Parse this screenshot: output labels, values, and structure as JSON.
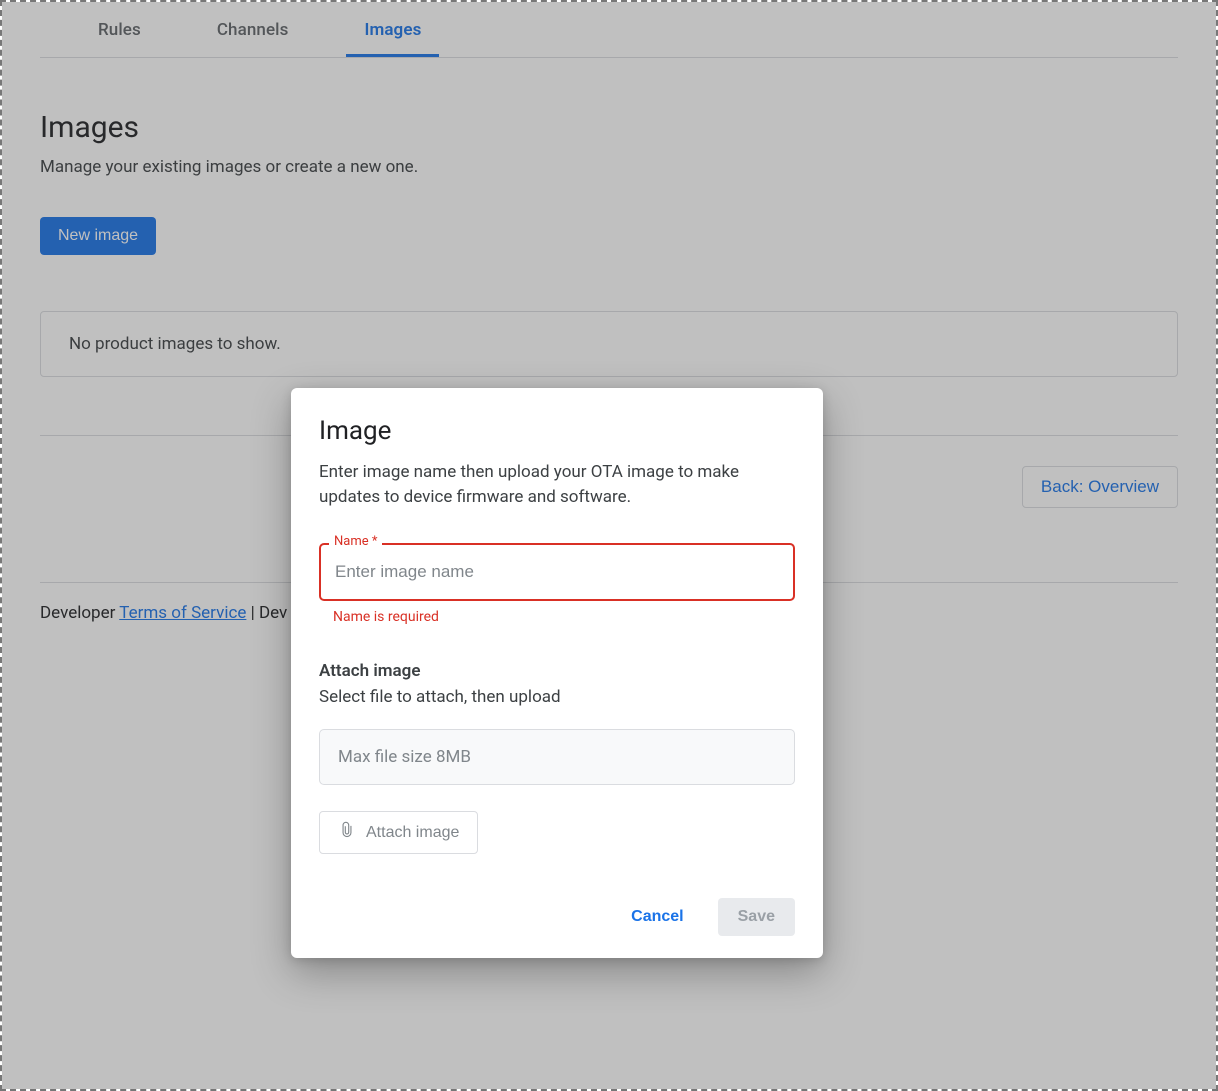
{
  "tabs": {
    "rules": "Rules",
    "channels": "Channels",
    "images": "Images"
  },
  "page": {
    "title": "Images",
    "description": "Manage your existing images or create a new one.",
    "new_image_button": "New image",
    "empty_state": "No product images to show.",
    "back_button": "Back: Overview"
  },
  "footer": {
    "prefix": "Developer ",
    "tos": "Terms of Service",
    "separator": " | ",
    "rest": "Dev"
  },
  "dialog": {
    "title": "Image",
    "subtitle": "Enter image name then upload your OTA image to make updates to device firmware and software.",
    "name_label": "Name *",
    "name_placeholder": "Enter image name",
    "name_value": "",
    "name_error": "Name is required",
    "attach_heading": "Attach image",
    "attach_desc": "Select file to attach, then upload",
    "file_box_placeholder": "Max file size 8MB",
    "attach_button": "Attach image",
    "cancel": "Cancel",
    "save": "Save"
  }
}
